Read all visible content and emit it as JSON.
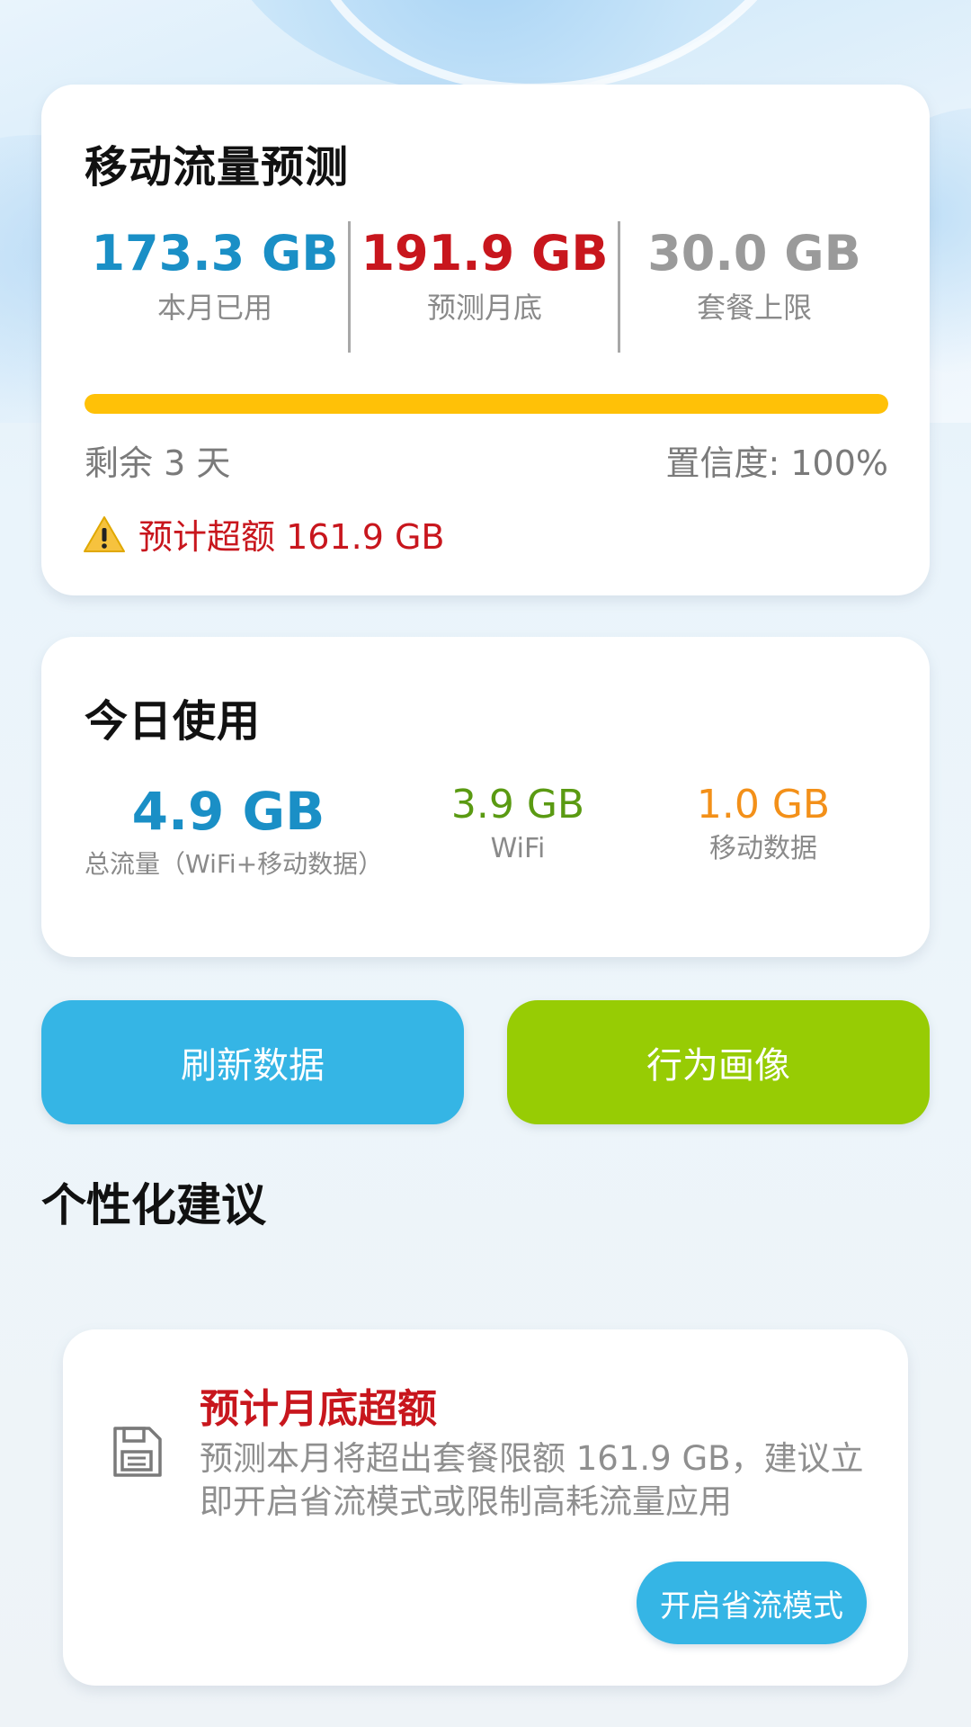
{
  "forecast": {
    "title": "移动流量预测",
    "used": {
      "value": "173.3 GB",
      "label": "本月已用",
      "color": "#1a8fc6"
    },
    "predicted": {
      "value": "191.9 GB",
      "label": "预测月底",
      "color": "#c8161d"
    },
    "limit": {
      "value": "30.0 GB",
      "label": "套餐上限",
      "color": "#9a9a9a"
    },
    "progress_fraction": 1.0,
    "progress_color": "#ffc107",
    "remaining": "剩余 3 天",
    "confidence": "置信度: 100%",
    "warning": "预计超额 161.9 GB"
  },
  "today": {
    "title": "今日使用",
    "total": {
      "value": "4.9 GB",
      "label": "总流量（WiFi+移动数据）"
    },
    "wifi": {
      "value": "3.9 GB",
      "label": "WiFi",
      "color": "#5a9a12"
    },
    "mobile": {
      "value": "1.0 GB",
      "label": "移动数据",
      "color": "#f39019"
    }
  },
  "actions": {
    "refresh_label": "刷新数据",
    "profile_label": "行为画像"
  },
  "suggestions": {
    "heading": "个性化建议",
    "items": [
      {
        "icon": "save-icon",
        "title": "预计月底超额",
        "description": "预测本月将超出套餐限额 161.9 GB，建议立即开启省流模式或限制高耗流量应用",
        "button_label": "开启省流模式"
      }
    ]
  }
}
